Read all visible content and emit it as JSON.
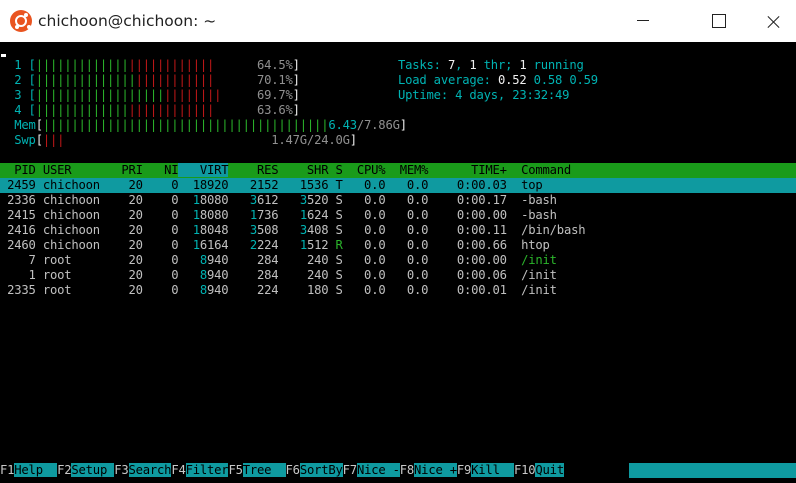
{
  "window": {
    "title": "chichoon@chichoon: ~"
  },
  "meters": {
    "cpu": [
      {
        "num": "1",
        "green": "|||||||||||||",
        "red": "||||||||||||",
        "pct": "64.5%"
      },
      {
        "num": "2",
        "green": "||||||||||||||",
        "red": "|||||||||||",
        "pct": "70.1%"
      },
      {
        "num": "3",
        "green": "||||||||||||||||||",
        "red": "||||||||",
        "pct": "69.7%"
      },
      {
        "num": "4",
        "green": "|||||||||||||",
        "red": "||||||||||||",
        "pct": "63.6%"
      }
    ],
    "mem": {
      "label": "Mem",
      "bars": "||||||||||||||||||||||||||||||||||||||||",
      "used": "6.43",
      "total": "/7.86G"
    },
    "swp": {
      "label": "Swp",
      "bars": "|||",
      "value": "1.47G/24.0G"
    },
    "tasks_label": "Tasks: ",
    "tasks_count": "7",
    "tasks_sep": ", ",
    "thr_count": "1",
    "thr_label": " thr; ",
    "running_count": "1",
    "running_label": " running",
    "load_label": "Load average: ",
    "load1": "0.52",
    "load5": "0.58",
    "load15": "0.59",
    "uptime_label": "Uptime: ",
    "uptime_value": "4 days, 23:32:49"
  },
  "columns": {
    "pid": "PID",
    "user": "USER",
    "pri": "PRI",
    "ni": "NI",
    "virt": "VIRT",
    "res": "RES",
    "shr": "SHR",
    "s": "S",
    "cpu": "CPU%",
    "mem": "MEM%",
    "time": "TIME+",
    "command": "Command"
  },
  "processes": [
    {
      "pid": "2459",
      "user": "chichoon",
      "pri": "20",
      "ni": "0",
      "virt": "18920",
      "res": "2152",
      "shr": "1536",
      "s": "T",
      "cpu": "0.0",
      "mem": "0.0",
      "time": "0:00.03",
      "command": "top"
    },
    {
      "pid": "2336",
      "user": "chichoon",
      "pri": "20",
      "ni": "0",
      "virt": "18080",
      "res": "3612",
      "shr": "3520",
      "s": "S",
      "cpu": "0.0",
      "mem": "0.0",
      "time": "0:00.17",
      "command": "-bash"
    },
    {
      "pid": "2415",
      "user": "chichoon",
      "pri": "20",
      "ni": "0",
      "virt": "18080",
      "res": "1736",
      "shr": "1624",
      "s": "S",
      "cpu": "0.0",
      "mem": "0.0",
      "time": "0:00.00",
      "command": "-bash"
    },
    {
      "pid": "2416",
      "user": "chichoon",
      "pri": "20",
      "ni": "0",
      "virt": "18048",
      "res": "3508",
      "shr": "3408",
      "s": "S",
      "cpu": "0.0",
      "mem": "0.0",
      "time": "0:00.11",
      "command": "/bin/bash"
    },
    {
      "pid": "2460",
      "user": "chichoon",
      "pri": "20",
      "ni": "0",
      "virt": "16164",
      "res": "2224",
      "shr": "1512",
      "s": "R",
      "cpu": "0.0",
      "mem": "0.0",
      "time": "0:00.66",
      "command": "htop"
    },
    {
      "pid": "7",
      "user": "root",
      "pri": "20",
      "ni": "0",
      "virt": "8940",
      "res": "284",
      "shr": "240",
      "s": "S",
      "cpu": "0.0",
      "mem": "0.0",
      "time": "0:00.00",
      "command": "/init"
    },
    {
      "pid": "1",
      "user": "root",
      "pri": "20",
      "ni": "0",
      "virt": "8940",
      "res": "284",
      "shr": "240",
      "s": "S",
      "cpu": "0.0",
      "mem": "0.0",
      "time": "0:00.06",
      "command": "/init"
    },
    {
      "pid": "2335",
      "user": "root",
      "pri": "20",
      "ni": "0",
      "virt": "8940",
      "res": "224",
      "shr": "180",
      "s": "S",
      "cpu": "0.0",
      "mem": "0.0",
      "time": "0:00.01",
      "command": "/init"
    }
  ],
  "footer": [
    {
      "key": "F1",
      "label": "Help  "
    },
    {
      "key": "F2",
      "label": "Setup "
    },
    {
      "key": "F3",
      "label": "Search"
    },
    {
      "key": "F4",
      "label": "Filter"
    },
    {
      "key": "F5",
      "label": "Tree  "
    },
    {
      "key": "F6",
      "label": "SortBy"
    },
    {
      "key": "F7",
      "label": "Nice -"
    },
    {
      "key": "F8",
      "label": "Nice +"
    },
    {
      "key": "F9",
      "label": "Kill  "
    },
    {
      "key": "F10",
      "label": "Quit"
    }
  ],
  "colors": {
    "header_bg": "#1a9b1a",
    "selected_bg": "#0f9aa0",
    "titlebar_bg": "#ffffff",
    "ubuntu_logo": "#e95420"
  }
}
